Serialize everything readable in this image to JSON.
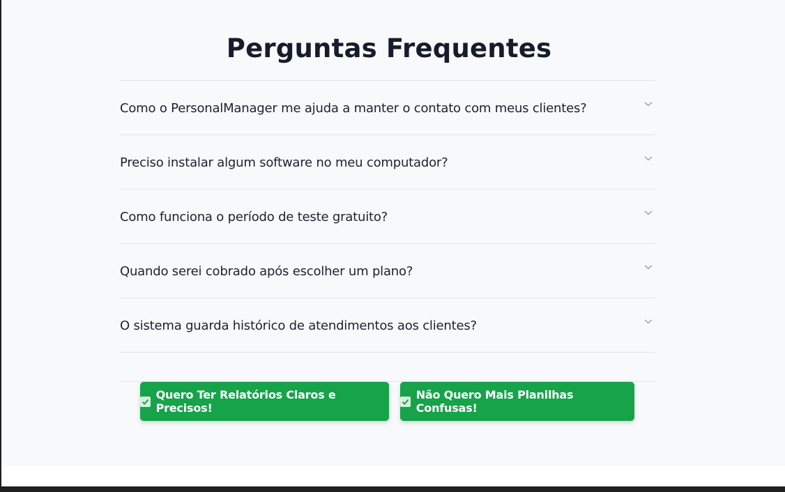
{
  "faq": {
    "title": "Perguntas Frequentes",
    "items": [
      {
        "question": "Como o PersonalManager me ajuda a manter o contato com meus clientes?"
      },
      {
        "question": "Preciso instalar algum software no meu computador?"
      },
      {
        "question": "Como funciona o período de teste gratuito?"
      },
      {
        "question": "Quando serei cobrado após escolher um plano?"
      },
      {
        "question": "O sistema guarda histórico de atendimentos aos clientes?"
      }
    ]
  },
  "cta": {
    "primary_label": "Quero Ter Relatórios Claros e Precisos!",
    "secondary_label": "Não Quero Mais Planilhas Confusas!",
    "icon": "check-box-icon"
  },
  "colors": {
    "button_green": "#16a34a",
    "title": "#151c2b",
    "background": "#f8f9fb"
  }
}
